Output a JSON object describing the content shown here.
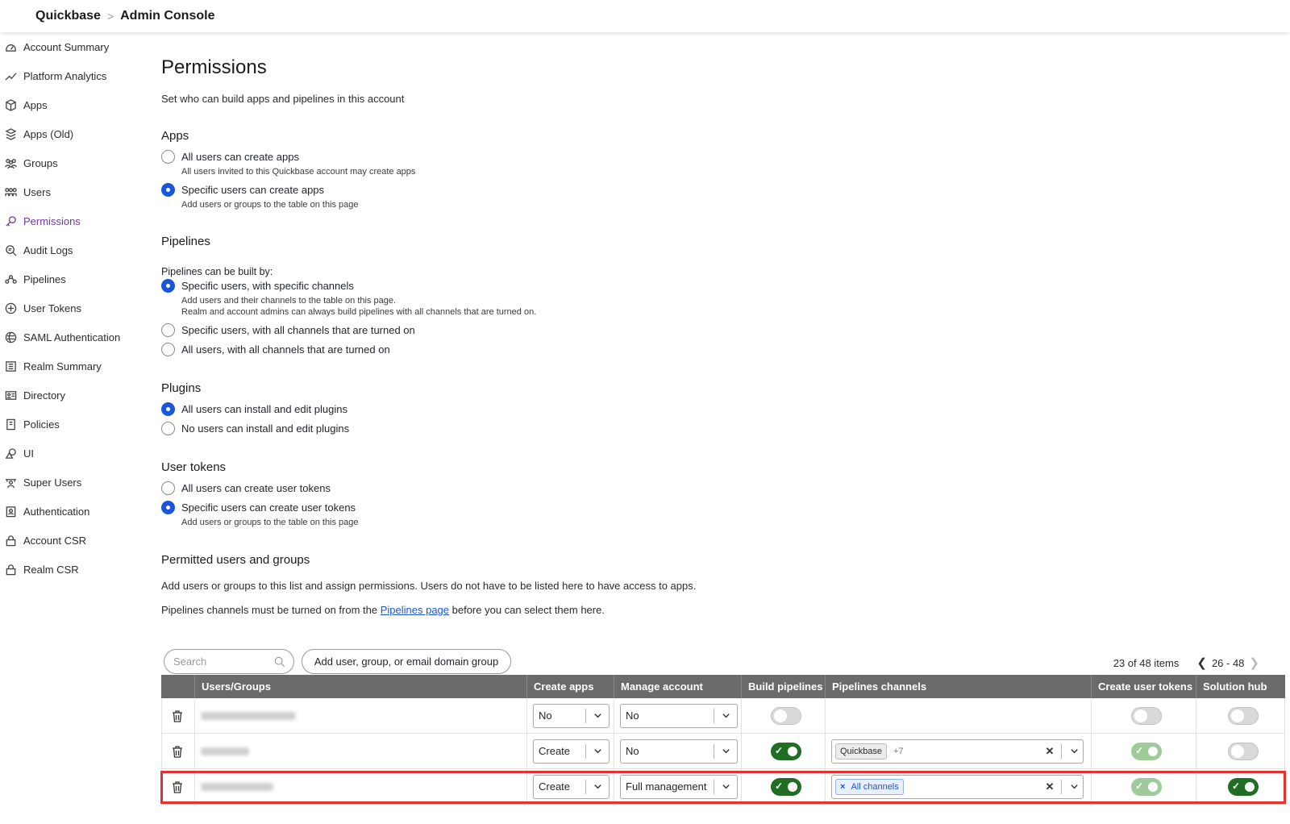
{
  "header": {
    "brand": "Quickbase",
    "separator": ">",
    "current": "Admin Console"
  },
  "sidebar": {
    "items": [
      {
        "label": "Account Summary",
        "icon": "gauge-icon"
      },
      {
        "label": "Platform Analytics",
        "icon": "trend-line-icon"
      },
      {
        "label": "Apps",
        "icon": "cube-icon"
      },
      {
        "label": "Apps (Old)",
        "icon": "cube-stack-icon"
      },
      {
        "label": "Groups",
        "icon": "groups-icon"
      },
      {
        "label": "Users",
        "icon": "users-icon"
      },
      {
        "label": "Permissions",
        "icon": "key-icon",
        "active": true
      },
      {
        "label": "Audit Logs",
        "icon": "audit-search-icon"
      },
      {
        "label": "Pipelines",
        "icon": "pipelines-icon"
      },
      {
        "label": "User Tokens",
        "icon": "token-icon"
      },
      {
        "label": "SAML Authentication",
        "icon": "globe-shield-icon"
      },
      {
        "label": "Realm Summary",
        "icon": "list-icon"
      },
      {
        "label": "Directory",
        "icon": "directory-card-icon"
      },
      {
        "label": "Policies",
        "icon": "document-icon"
      },
      {
        "label": "UI",
        "icon": "shapes-icon"
      },
      {
        "label": "Super Users",
        "icon": "super-users-icon"
      },
      {
        "label": "Authentication",
        "icon": "lock-badge-icon"
      },
      {
        "label": "Account CSR",
        "icon": "lock-icon"
      },
      {
        "label": "Realm CSR",
        "icon": "lock-icon"
      }
    ]
  },
  "page": {
    "title": "Permissions",
    "subtitle": "Set who can build apps and pipelines in this account"
  },
  "apps": {
    "title": "Apps",
    "opt1": "All users can create apps",
    "opt1_help": "All users invited to this Quickbase account may create apps",
    "opt2": "Specific users can create apps",
    "opt2_help": "Add users or groups to the table on this page",
    "selected": "opt2"
  },
  "pipelines": {
    "title": "Pipelines",
    "label": "Pipelines can be built by:",
    "opt1": "Specific users, with specific channels",
    "opt1_help1": "Add users and their channels to the table on this page.",
    "opt1_help2": "Realm and account admins can always build pipelines with all channels that are turned on.",
    "opt2": "Specific users, with all channels that are turned on",
    "opt3": "All users, with all channels that are turned on",
    "selected": "opt1"
  },
  "plugins": {
    "title": "Plugins",
    "opt1": "All users can install and edit plugins",
    "opt2": "No users can install and edit plugins",
    "selected": "opt1"
  },
  "user_tokens": {
    "title": "User tokens",
    "opt1": "All users can create user tokens",
    "opt2": "Specific users can create user tokens",
    "opt2_help": "Add users or groups to the table on this page",
    "selected": "opt2"
  },
  "permitted": {
    "title": "Permitted users and groups",
    "desc": "Add users or groups to this list and assign permissions. Users do not have to be listed here to have access to apps.",
    "note_before": "Pipelines channels must be turned on from the ",
    "note_link": "Pipelines page",
    "note_after": " before you can select them here."
  },
  "search": {
    "placeholder": "Search",
    "value": ""
  },
  "add_button": "Add user, group, or email domain group",
  "pager": {
    "count": "23 of 48 items",
    "range": "26 - 48"
  },
  "table": {
    "headers": [
      "Users/Groups",
      "Create apps",
      "Manage account",
      "Build pipelines",
      "Pipelines channels",
      "Create user tokens",
      "Solution hub"
    ],
    "rows": [
      {
        "create_apps": "No",
        "manage_account": "No",
        "build_pipelines": false,
        "channels_chip": "",
        "channels_more": "",
        "create_tokens": "off",
        "solution_hub": "off"
      },
      {
        "create_apps": "Create",
        "manage_account": "No",
        "build_pipelines": true,
        "channels_chip": "Quickbase",
        "channels_more": "+7",
        "create_tokens": "on-dim",
        "solution_hub": "off"
      },
      {
        "create_apps": "Create",
        "manage_account": "Full management",
        "build_pipelines": true,
        "channels_chip": "All channels",
        "channels_more": "",
        "create_tokens": "on-dim",
        "solution_hub": "on"
      }
    ]
  },
  "colors": {
    "accent": "#1a56db",
    "active_nav": "#6b3aa0",
    "toggle_on": "#1f6e24",
    "highlight": "#e5302f"
  }
}
